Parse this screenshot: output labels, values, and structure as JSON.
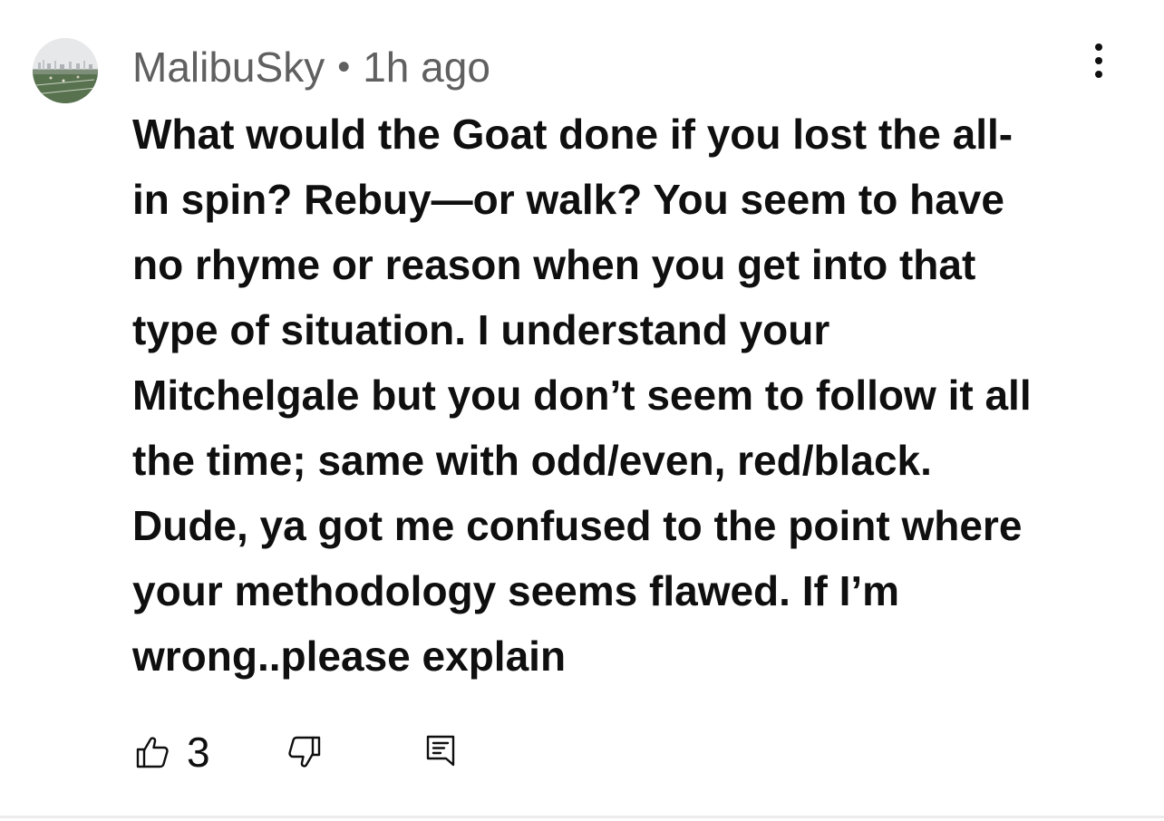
{
  "comment": {
    "author": "MalibuSky",
    "separator": "•",
    "time": "1h ago",
    "text_lines": [
      "What would the Goat done if you lost the all-",
      "in spin? Rebuy—or walk?  You seem to have",
      "no rhyme or reason when you get into that",
      "type of situation. I understand your",
      "Mitchelgale but you don’t seem to follow it all",
      "the time; same with odd/even, red/black.",
      "Dude, ya got me confused to the point where",
      "your methodology seems flawed. If I’m",
      "wrong..please explain"
    ],
    "likes": "3"
  },
  "icons": {
    "avatar": "avatar-photo-field",
    "menu": "kebab-menu-icon",
    "like": "thumbs-up-icon",
    "dislike": "thumbs-down-icon",
    "reply": "reply-comment-icon"
  }
}
